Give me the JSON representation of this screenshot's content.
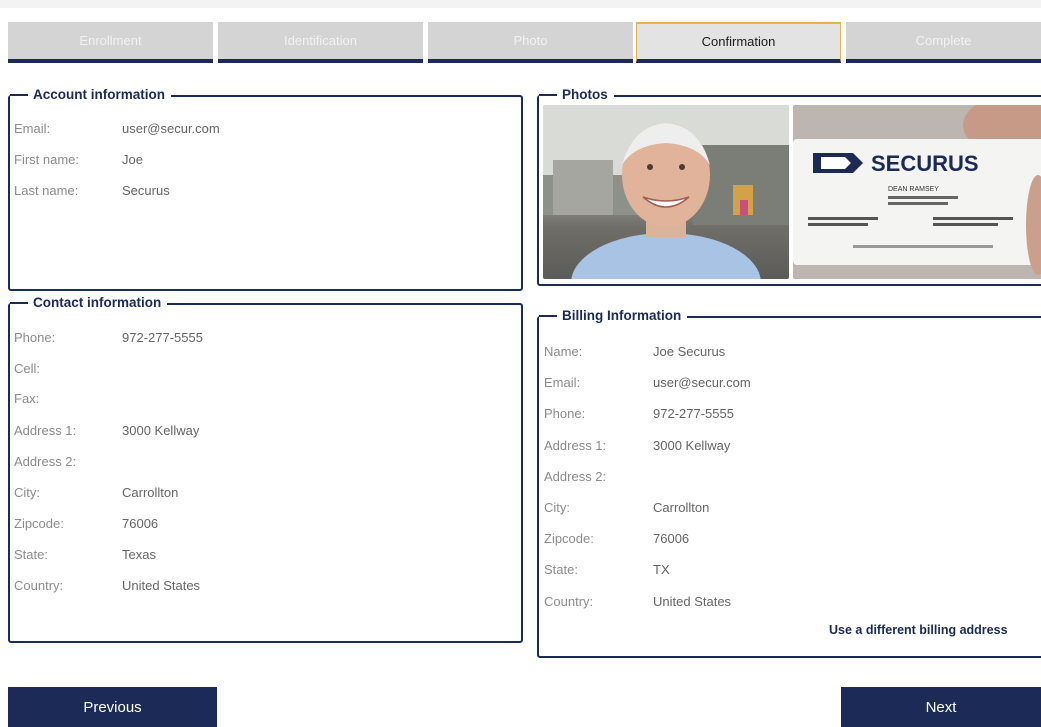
{
  "steps": [
    {
      "label": "Enrollment",
      "active": false
    },
    {
      "label": "Identification",
      "active": false
    },
    {
      "label": "Photo",
      "active": false
    },
    {
      "label": "Confirmation",
      "active": true
    },
    {
      "label": "Complete",
      "active": false
    }
  ],
  "account": {
    "legend": "Account information",
    "email_label": "Email:",
    "email": "user@secur.com",
    "first_label": "First name:",
    "first": "Joe",
    "last_label": "Last name:",
    "last": "Securus"
  },
  "contact": {
    "legend": "Contact information",
    "phone_label": "Phone:",
    "phone": "972-277-5555",
    "cell_label": "Cell:",
    "cell": "",
    "fax_label": "Fax:",
    "fax": "",
    "addr1_label": "Address 1:",
    "addr1": "3000 Kellway",
    "addr2_label": "Address 2:",
    "addr2": "",
    "city_label": "City:",
    "city": "Carrollton",
    "zip_label": "Zipcode:",
    "zip": "76006",
    "state_label": "State:",
    "state": "Texas",
    "country_label": "Country:",
    "country": "United States"
  },
  "photos": {
    "legend": "Photos",
    "card_brand": "SECURUS",
    "card_name": "DEAN RAMSEY"
  },
  "billing": {
    "legend": "Billing Information",
    "name_label": "Name:",
    "name": "Joe Securus",
    "email_label": "Email:",
    "email": "user@secur.com",
    "phone_label": "Phone:",
    "phone": "972-277-5555",
    "addr1_label": "Address 1:",
    "addr1": "3000 Kellway",
    "addr2_label": "Address 2:",
    "addr2": "",
    "city_label": "City:",
    "city": "Carrollton",
    "zip_label": "Zipcode:",
    "zip": "76006",
    "state_label": "State:",
    "state": "TX",
    "country_label": "Country:",
    "country": "United States",
    "different_link": "Use a different billing address"
  },
  "nav": {
    "previous": "Previous",
    "next": "Next"
  },
  "colors": {
    "primary": "#1b2a57",
    "accent": "#e6b34a",
    "step_bg": "#d4d4d4"
  }
}
